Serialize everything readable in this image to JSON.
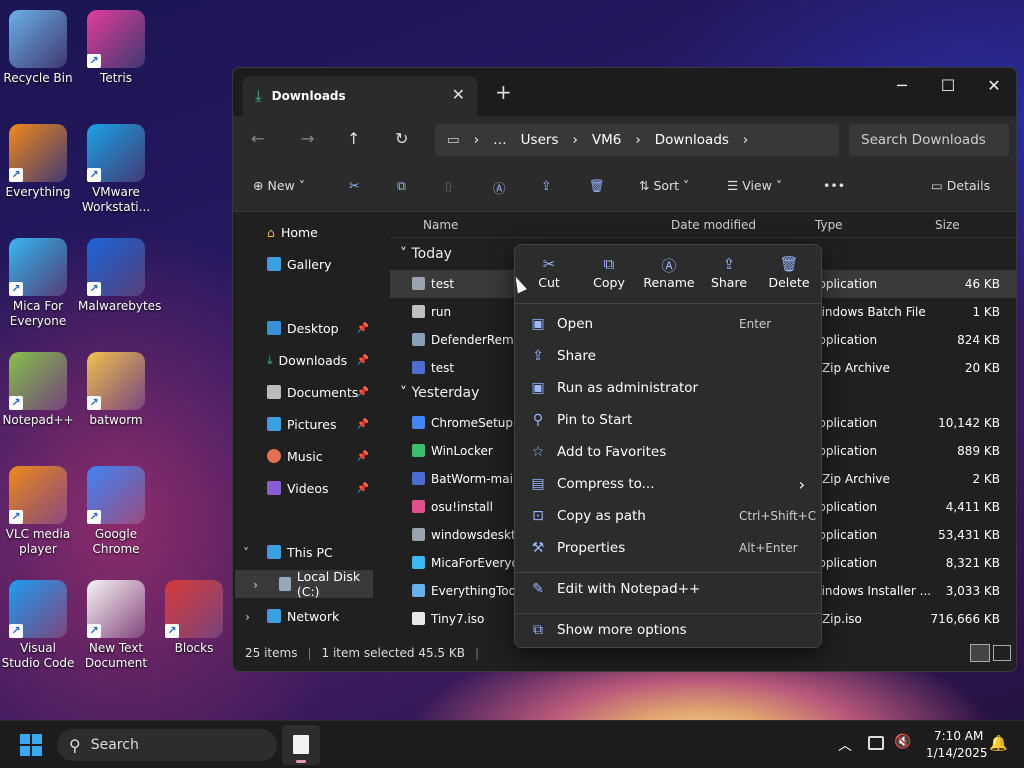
{
  "desktop": {
    "icons": [
      {
        "label": "Recycle Bin",
        "icon": "recycle-bin-icon",
        "color": "#6ab0e8"
      },
      {
        "label": "Tetris",
        "icon": "tetris-icon",
        "color": "#e23c9c"
      },
      {
        "label": "Everything",
        "icon": "everything-icon",
        "color": "#f08a1a"
      },
      {
        "label": "VMware Workstati...",
        "icon": "vmware-icon",
        "color": "#1aa3e8"
      },
      {
        "label": "Mica For Everyone",
        "icon": "mica-icon",
        "color": "#3ab8f0"
      },
      {
        "label": "Malwarebytes",
        "icon": "malwarebytes-icon",
        "color": "#1e66d9"
      },
      {
        "label": "Notepad++",
        "icon": "notepadpp-icon",
        "color": "#8cc04a"
      },
      {
        "label": "batworm",
        "icon": "folder-icon",
        "color": "#f2c14e"
      },
      {
        "label": "VLC media player",
        "icon": "vlc-icon",
        "color": "#f08a1a"
      },
      {
        "label": "Google Chrome",
        "icon": "chrome-icon",
        "color": "#4285f4"
      },
      {
        "label": "Visual Studio Code",
        "icon": "vscode-icon",
        "color": "#1f9cf0"
      },
      {
        "label": "New Text Document",
        "icon": "text-document-icon",
        "color": "#f4f4f4"
      },
      {
        "label": "Blocks",
        "icon": "blocks-icon",
        "color": "#d33a3a"
      }
    ]
  },
  "explorer": {
    "tab_title": "Downloads",
    "tab_close": "✕",
    "new_tab": "+",
    "window_controls": {
      "minimize": "─",
      "maximize": "☐",
      "close": "✕"
    },
    "breadcrumbs": [
      "…",
      "Users",
      "VM6",
      "Downloads"
    ],
    "crumb_sep": "›",
    "search_placeholder": "Search Downloads",
    "toolbar": {
      "new": "New",
      "sort": "Sort",
      "view": "View",
      "more": "•••",
      "details": "Details"
    },
    "nav": {
      "home": "Home",
      "gallery": "Gallery",
      "desktop": "Desktop",
      "downloads": "Downloads",
      "documents": "Documents",
      "pictures": "Pictures",
      "music": "Music",
      "videos": "Videos",
      "this_pc": "This PC",
      "local_disk": "Local Disk (C:)",
      "network": "Network"
    },
    "columns": {
      "name": "Name",
      "date": "Date modified",
      "type": "Type",
      "size": "Size"
    },
    "groups": {
      "today": "Today",
      "yesterday": "Yesterday"
    },
    "files": [
      {
        "name": "test",
        "type": "Application",
        "size": "46 KB",
        "color": "#9aa4b0"
      },
      {
        "name": "run",
        "type": "Windows Batch File",
        "size": "1 KB",
        "color": "#c0c0c0"
      },
      {
        "name": "DefenderRemov",
        "type": "Application",
        "size": "824 KB",
        "color": "#8a9fb8"
      },
      {
        "name": "test",
        "type": "7-Zip Archive",
        "size": "20 KB",
        "color": "#4a6fd0"
      },
      {
        "name": "ChromeSetup",
        "type": "Application",
        "size": "10,142 KB",
        "color": "#4285f4"
      },
      {
        "name": "WinLocker",
        "type": "Application",
        "size": "889 KB",
        "color": "#3ac06a"
      },
      {
        "name": "BatWorm-main",
        "type": "7-Zip Archive",
        "size": "2 KB",
        "color": "#4a6fd0"
      },
      {
        "name": "osu!install",
        "type": "Application",
        "size": "4,411 KB",
        "color": "#e0508c"
      },
      {
        "name": "windowsdeskto",
        "type": "Application",
        "size": "53,431 KB",
        "color": "#9aa4b0"
      },
      {
        "name": "MicaForEveryon",
        "type": "Application",
        "size": "8,321 KB",
        "color": "#3ab8f0"
      },
      {
        "name": "EverythingToolb",
        "type": "Windows Installer ...",
        "size": "3,033 KB",
        "color": "#6ab0e8"
      },
      {
        "name": "Tiny7.iso",
        "type": "7-Zip.iso",
        "size": "716,666 KB",
        "color": "#e8e8e8"
      }
    ],
    "status": {
      "count": "25 items",
      "selected": "1 item selected  45.5 KB"
    }
  },
  "context_menu": {
    "quick": [
      {
        "label": "Cut",
        "icon": "✂"
      },
      {
        "label": "Copy",
        "icon": "⧉"
      },
      {
        "label": "Rename",
        "icon": "Ⓐ"
      },
      {
        "label": "Share",
        "icon": "⇪"
      },
      {
        "label": "Delete",
        "icon": "🗑"
      }
    ],
    "items": [
      {
        "label": "Open",
        "shortcut": "Enter",
        "icon": "▣"
      },
      {
        "label": "Share",
        "shortcut": "",
        "icon": "⇪"
      },
      {
        "label": "Run as administrator",
        "shortcut": "",
        "icon": "▣"
      },
      {
        "label": "Pin to Start",
        "shortcut": "",
        "icon": "⚲"
      },
      {
        "label": "Add to Favorites",
        "shortcut": "",
        "icon": "☆"
      },
      {
        "label": "Compress to...",
        "shortcut": "",
        "icon": "▤"
      },
      {
        "label": "Copy as path",
        "shortcut": "Ctrl+Shift+C",
        "icon": "⊡"
      },
      {
        "label": "Properties",
        "shortcut": "Alt+Enter",
        "icon": "⚒"
      },
      {
        "label": "Edit with Notepad++",
        "shortcut": "",
        "icon": "✎"
      },
      {
        "label": "Show more options",
        "shortcut": "",
        "icon": "⧉"
      }
    ],
    "submenu_arrow": "›"
  },
  "taskbar": {
    "search": "Search",
    "time": "7:10 AM",
    "date": "1/14/2025"
  }
}
